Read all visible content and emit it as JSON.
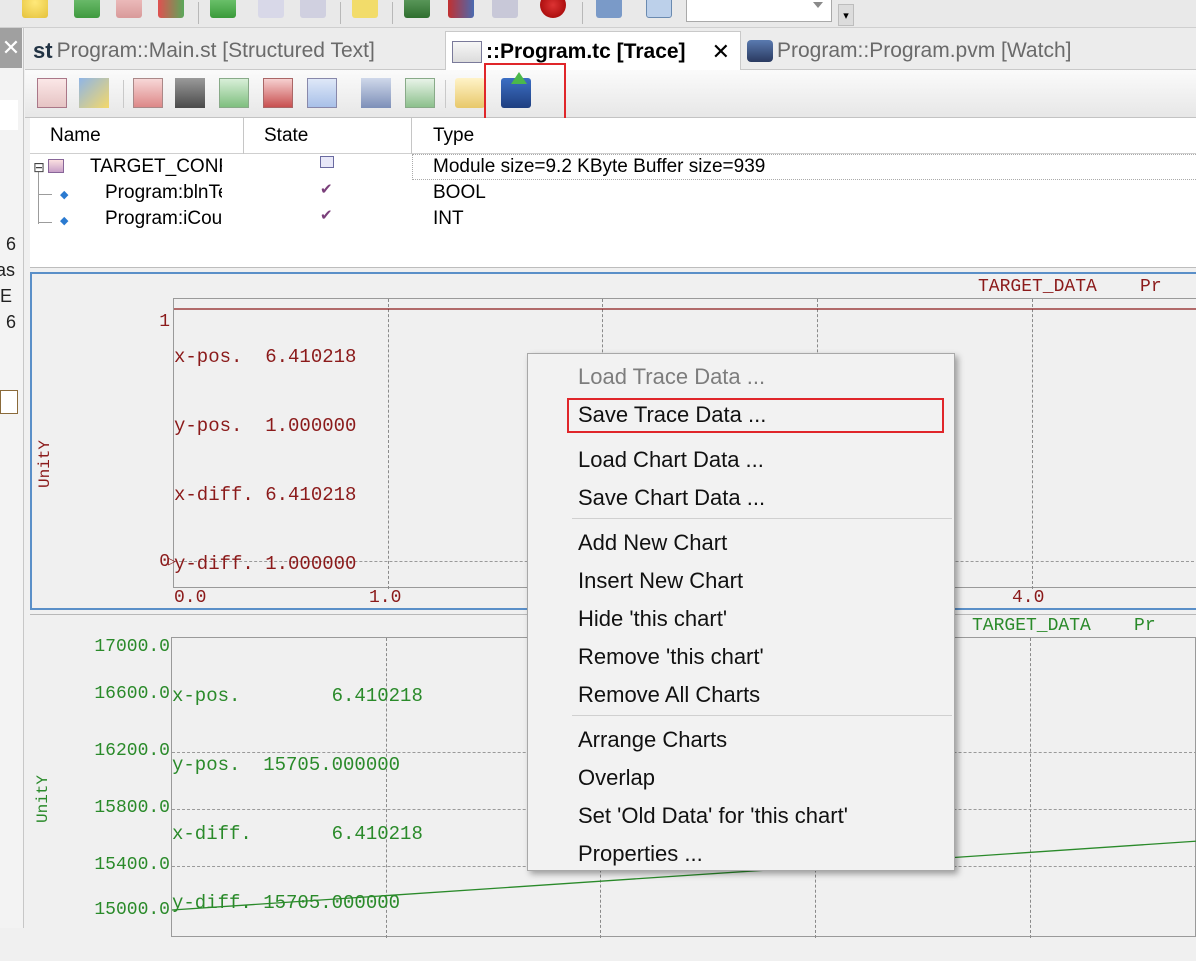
{
  "tabs": [
    {
      "label": "Program::Main.st [Structured Text]"
    },
    {
      "label": "::Program.tc [Trace]"
    },
    {
      "label": "Program::Program.pvm [Watch]"
    }
  ],
  "tab_close_glyph": "✕",
  "left_panel": {
    "close_glyph": "✕",
    "fragments": [
      "6",
      "as",
      "E",
      "6"
    ]
  },
  "toolbar_overflow_glyph": "▾",
  "tree": {
    "columns": [
      "Name",
      "State",
      "Type"
    ],
    "rows": [
      {
        "name": "TARGET_CONFIG",
        "type": "Module size=9.2 KByte   Buffer size=939",
        "expander": "⊟"
      },
      {
        "name": "Program:blnTest",
        "type": "BOOL"
      },
      {
        "name": "Program:iCount",
        "type": "INT"
      }
    ]
  },
  "chart1": {
    "legend": "TARGET_DATA    Pr",
    "readout": [
      "x-pos.  6.410218",
      "y-pos.  1.000000",
      "x-diff. 6.410218",
      "y-diff. 1.000000"
    ],
    "y_ticks": [
      "1",
      "0"
    ],
    "x_ticks": [
      "0.0",
      "1.0",
      "4.0"
    ],
    "y_title": "UnitY",
    "color": "#8b1a1a"
  },
  "chart2": {
    "legend": "TARGET_DATA    Pr",
    "readout": [
      "x-pos.        6.410218",
      "y-pos.  15705.000000",
      "x-diff.       6.410218",
      "y-diff. 15705.000000"
    ],
    "y_ticks": [
      "17000.0",
      "16600.0",
      "16200.0",
      "15800.0",
      "15400.0",
      "15000.0"
    ],
    "y_title": "UnitY",
    "color": "#2a8a2a"
  },
  "chart_data": [
    {
      "type": "line",
      "title": "",
      "xlabel": "",
      "ylabel": "UnitY",
      "series": [
        {
          "name": "TARGET_DATA",
          "x": [
            0.0,
            6.410218
          ],
          "y": [
            1.0,
            1.0
          ]
        }
      ],
      "ylim": [
        0,
        1
      ]
    },
    {
      "type": "line",
      "title": "",
      "xlabel": "",
      "ylabel": "UnitY",
      "series": [
        {
          "name": "TARGET_DATA",
          "x": [
            0.0,
            6.410218
          ],
          "y": [
            15000.0,
            15705.0
          ]
        }
      ],
      "ylim": [
        15000.0,
        17000.0
      ]
    }
  ],
  "context_menu": {
    "items": [
      {
        "label": "Load Trace Data ...",
        "disabled": true
      },
      {
        "label": "Save Trace Data ..."
      },
      {
        "label": "Load Chart Data ..."
      },
      {
        "label": "Save Chart Data ..."
      },
      {
        "label": "Add New Chart"
      },
      {
        "label": "Insert New Chart"
      },
      {
        "label": "Hide 'this chart'"
      },
      {
        "label": "Remove 'this chart'"
      },
      {
        "label": "Remove All Charts"
      },
      {
        "label": "Arrange Charts"
      },
      {
        "label": "Overlap"
      },
      {
        "label": "Set 'Old Data' for 'this chart'"
      },
      {
        "label": "Properties ..."
      }
    ]
  },
  "icons": {
    "top_toolbar": [
      "lightbulb-icon",
      "green-down-arrow-icon",
      "pink-down-arrow-icon",
      "red-green-arrow-icon",
      "play-icon",
      "step-over-icon",
      "step-out-icon",
      "tag-icon",
      "download-icon",
      "transfer-icon",
      "cpu-icon",
      "bug-icon",
      "network-icon",
      "fb-icon"
    ],
    "trace_toolbar": [
      "trace-chart-icon",
      "trace-edit-icon",
      "trace-add-icon",
      "trace-delete-icon",
      "trace-start-icon",
      "trace-stop-icon",
      "trace-compare-icon",
      "trace-window-icon",
      "trace-upload-icon",
      "open-folder-icon",
      "save-upload-icon"
    ]
  },
  "highlight_color": "#e0262a"
}
